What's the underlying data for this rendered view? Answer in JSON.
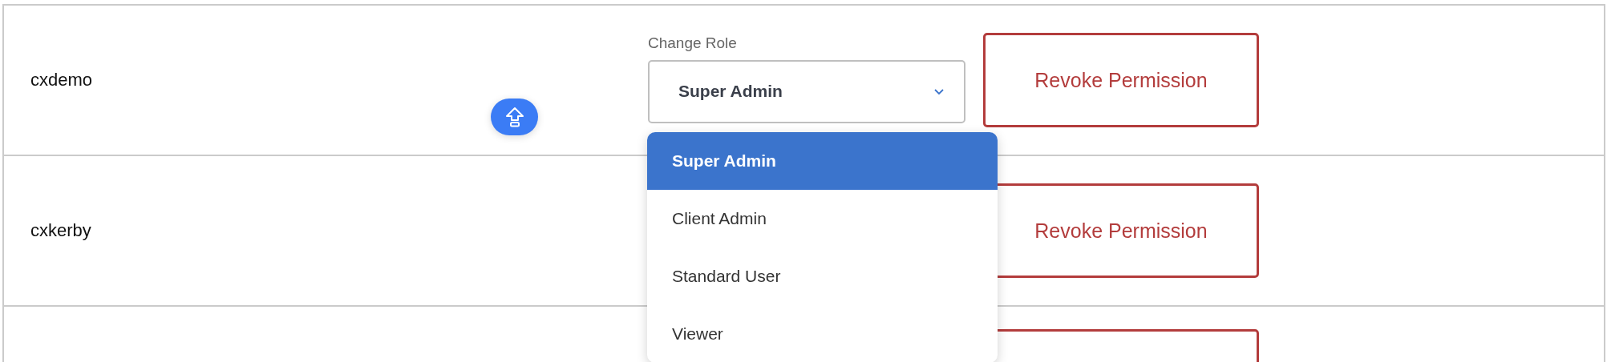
{
  "users": [
    {
      "username": "cxdemo",
      "role_field": {
        "label": "Change Role",
        "value": "Super Admin",
        "open": true
      },
      "action": "Revoke Permission"
    },
    {
      "username": "cxkerby",
      "action": "Revoke Permission"
    },
    {
      "kind": "cut"
    }
  ],
  "role_menu": {
    "options": [
      {
        "label": "Super Admin",
        "selected": true
      },
      {
        "label": "Client Admin",
        "selected": false
      },
      {
        "label": "Standard User",
        "selected": false
      },
      {
        "label": "Viewer",
        "selected": false
      }
    ]
  }
}
